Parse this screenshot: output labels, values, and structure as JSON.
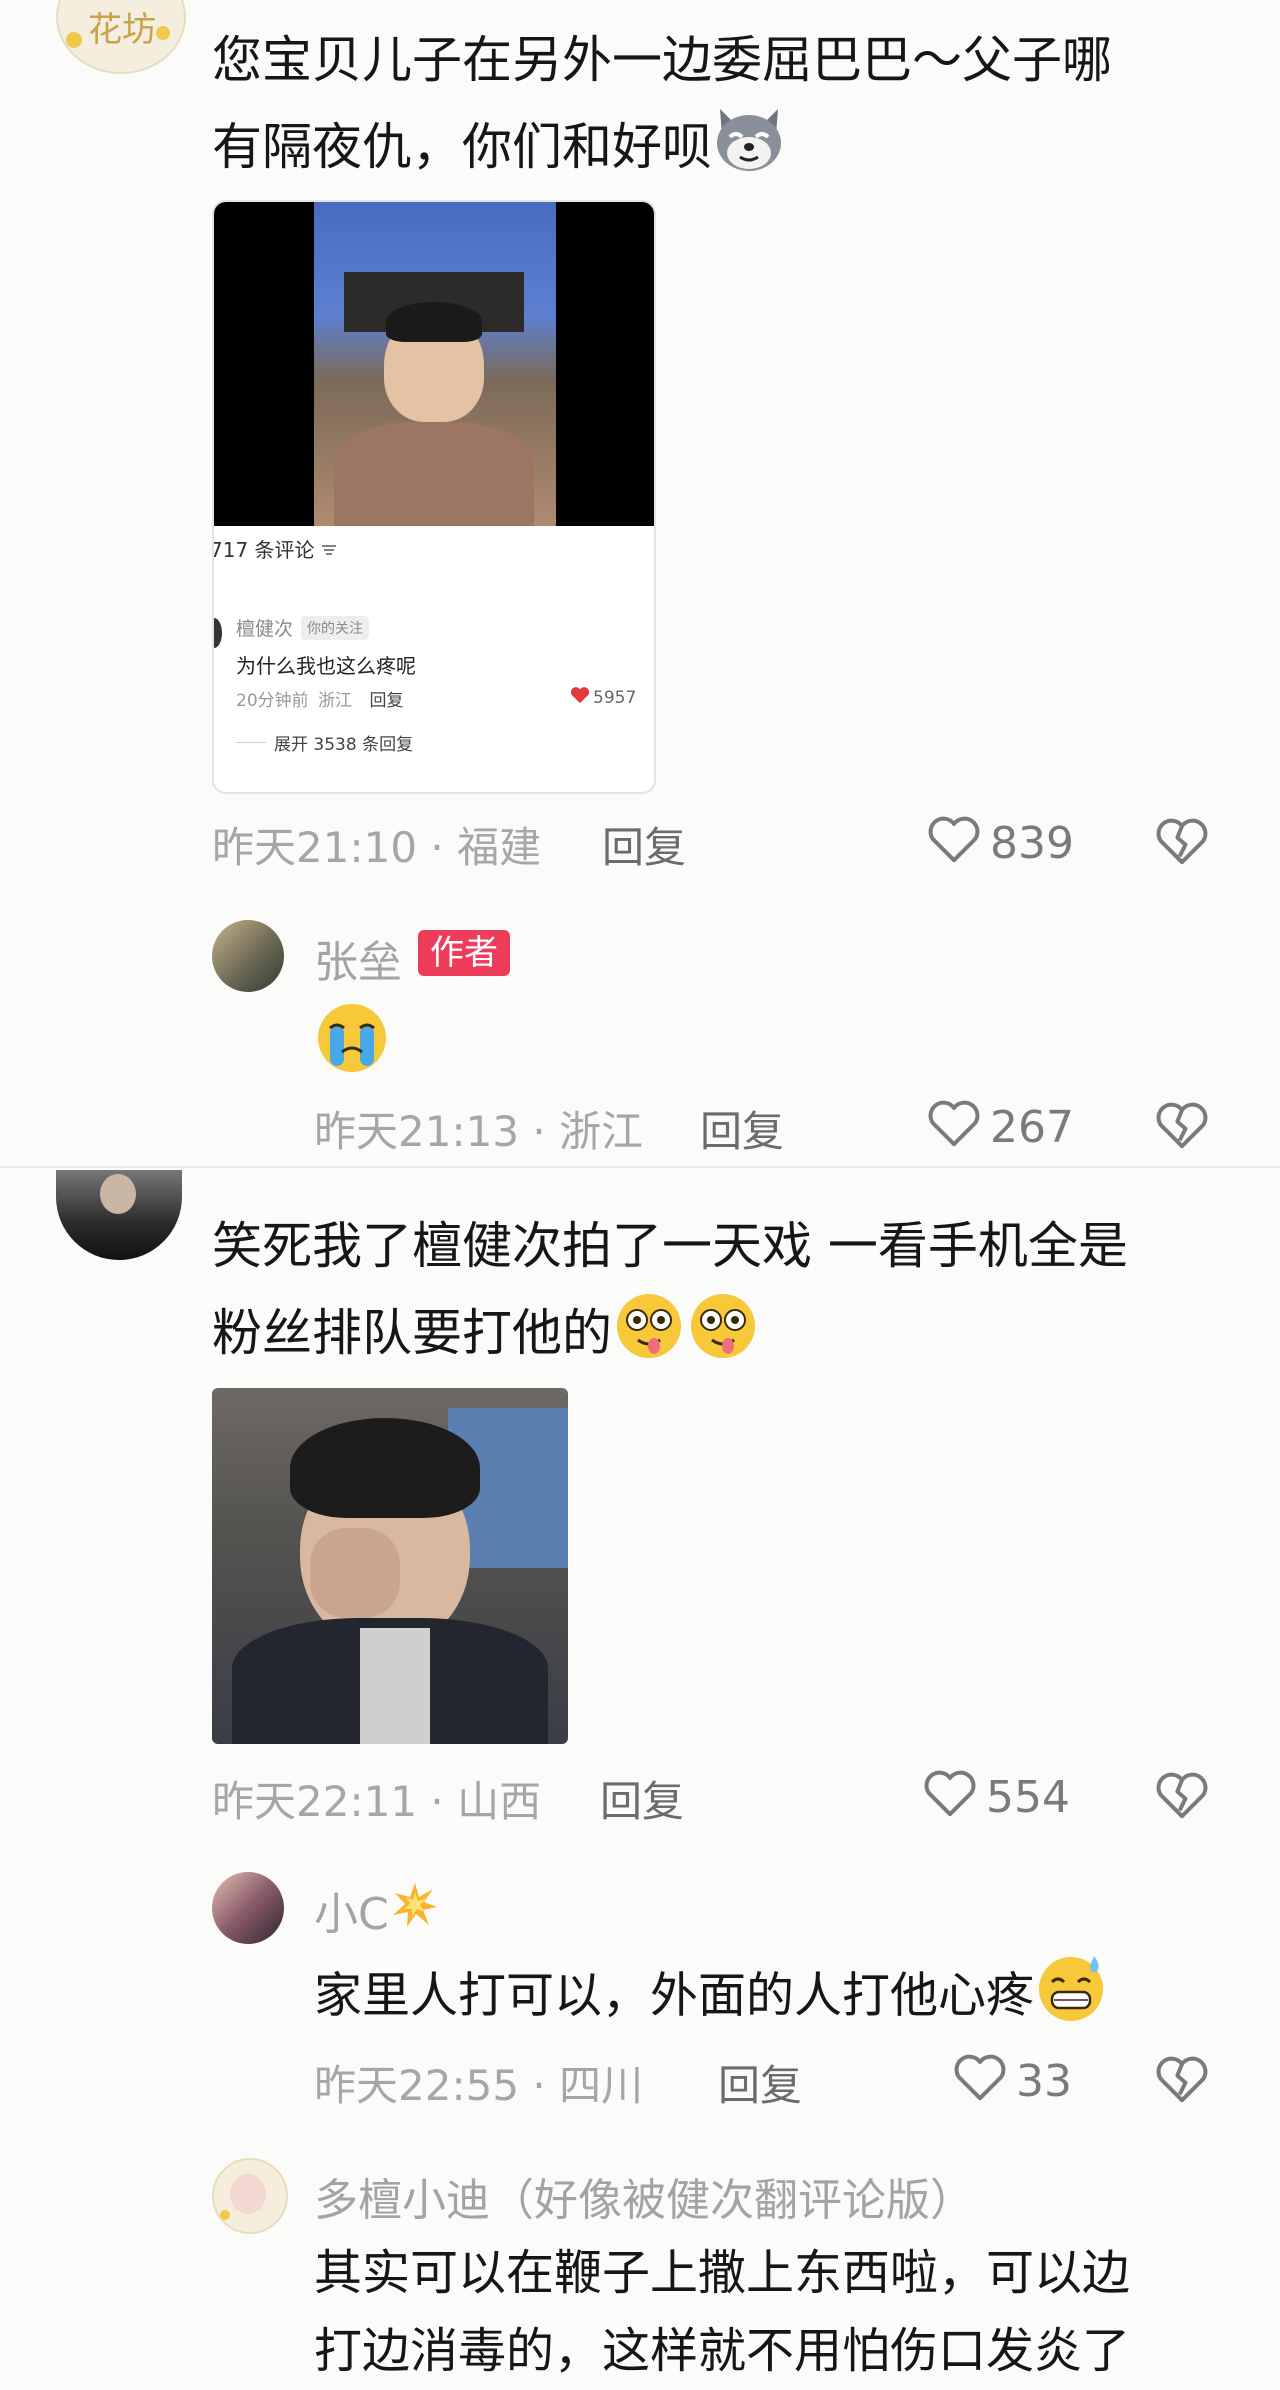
{
  "comments": [
    {
      "text_line1": "您宝贝儿子在另外一边委屈巴巴～父子哪",
      "text_line2": "有隔夜仇，你们和好呗",
      "avatar_text": "花坊",
      "screenshot": {
        "comment_count": "717 条评论",
        "user": "檀健次",
        "user_tag": "你的关注",
        "text": "为什么我也这么疼呢",
        "time": "20分钟前",
        "location": "浙江",
        "reply_label": "回复",
        "likes": "5957",
        "expand": "展开 3538 条回复"
      },
      "meta": "昨天21:10 · 福建",
      "reply_label": "回复",
      "likes": "839"
    },
    {
      "user": "张垒",
      "badge": "作者",
      "meta": "昨天21:13 · 浙江",
      "reply_label": "回复",
      "likes": "267"
    },
    {
      "text_line1": "笑死我了檀健次拍了一天戏 一看手机全是",
      "text_line2": "粉丝排队要打他的",
      "meta": "昨天22:11 · 山西",
      "reply_label": "回复",
      "likes": "554"
    },
    {
      "user": "小C",
      "text": "家里人打可以，外面的人打他心疼",
      "meta": "昨天22:55 · 四川",
      "reply_label": "回复",
      "likes": "33"
    },
    {
      "user": "多檀小迪（好像被健次翻评论版）",
      "text_line1": "其实可以在鞭子上撒上东西啦，可以边",
      "text_line2": "打边消毒的，这样就不用怕伤口发炎了"
    }
  ],
  "colors": {
    "badge": "#ee3d5a",
    "like_heart": "#e23b3b"
  },
  "icons": [
    "heart-outline-icon",
    "broken-heart-icon",
    "heart-filled-icon",
    "sort-icon"
  ]
}
